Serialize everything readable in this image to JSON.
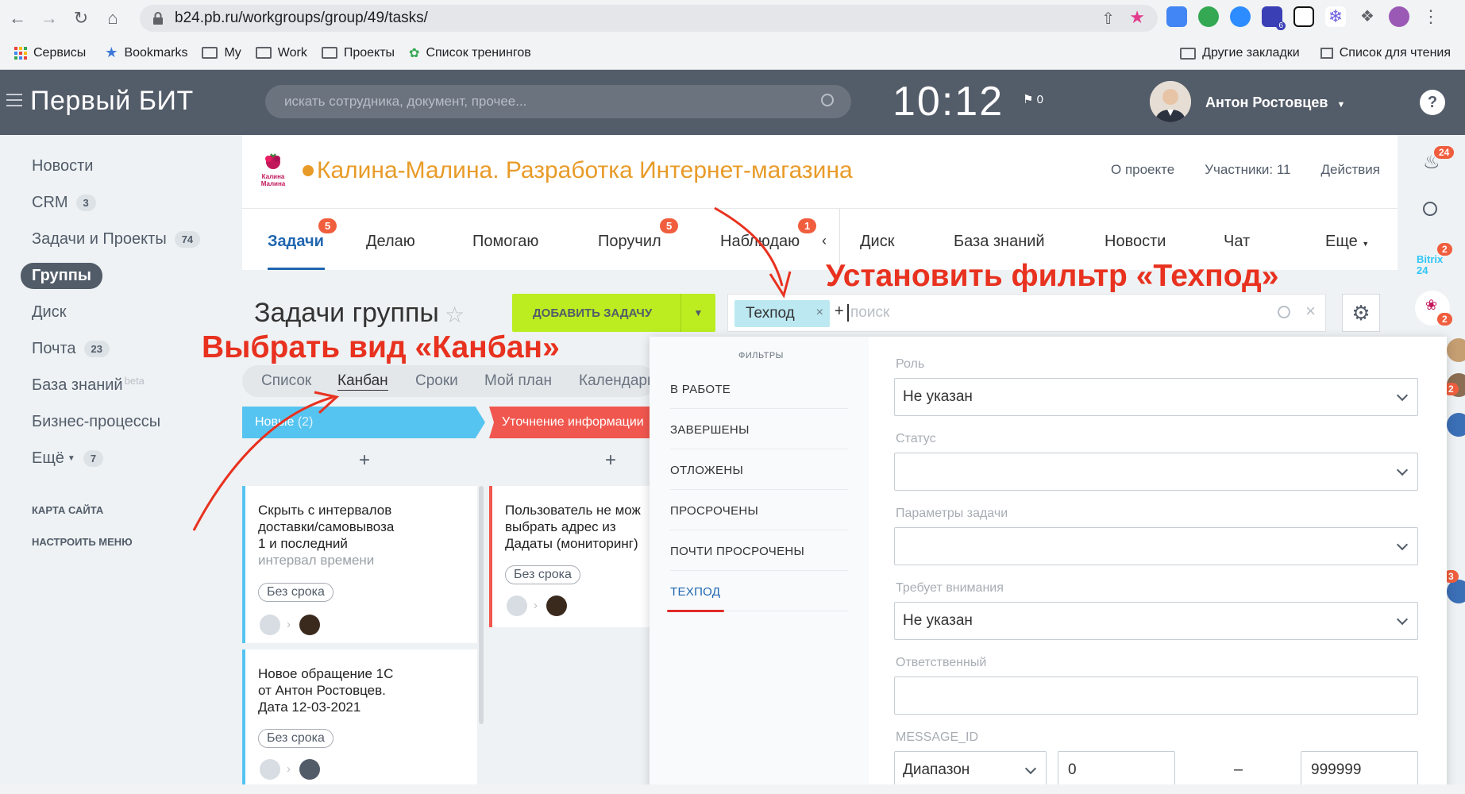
{
  "browser": {
    "url": "b24.pb.ru/workgroups/group/49/tasks/",
    "bookmarks": [
      "Сервисы",
      "Bookmarks",
      "My",
      "Work",
      "Проекты",
      "Список тренингов"
    ],
    "bookmarks_right": [
      "Другие закладки",
      "Список для чтения"
    ],
    "ext_badge": "6"
  },
  "header": {
    "brand": "Первый БИТ",
    "search_placeholder": "искать сотрудника, документ, прочее...",
    "time": "10:12",
    "flag_count": "0",
    "user_name": "Антон Ростовцев",
    "help": "?"
  },
  "left_menu": {
    "items": [
      {
        "label": "Новости"
      },
      {
        "label": "CRM",
        "count": "3"
      },
      {
        "label": "Задачи и Проекты",
        "count": "74"
      },
      {
        "label": "Группы"
      },
      {
        "label": "Диск"
      },
      {
        "label": "Почта",
        "count": "23"
      },
      {
        "label": "База знаний",
        "suffix": "beta"
      },
      {
        "label": "Бизнес-процессы"
      },
      {
        "label": "Ещё",
        "count": "7"
      }
    ],
    "sitemap": "КАРТА САЙТА",
    "configure": "НАСТРОИТЬ МЕНЮ"
  },
  "right_rail": {
    "bell_count": "24",
    "bitrix_count": "2",
    "logo_badge": "2",
    "edge_badge_1": "2",
    "edge_badge_2": "3",
    "bitrix_label": "Bitrix 24"
  },
  "project": {
    "title": "Калина-Малина. Разработка Интернет-магазина",
    "logo_text": "Калина Малина",
    "links": [
      "О проекте",
      "Участники: 11",
      "Действия"
    ]
  },
  "tabs": [
    {
      "label": "Задачи",
      "badge": "5"
    },
    {
      "label": "Делаю"
    },
    {
      "label": "Помогаю"
    },
    {
      "label": "Поручил",
      "badge": "5"
    },
    {
      "label": "Наблюдаю",
      "badge": "1"
    },
    {
      "label": "Диск"
    },
    {
      "label": "База знаний"
    },
    {
      "label": "Новости"
    },
    {
      "label": "Чат"
    },
    {
      "label": "Еще"
    }
  ],
  "page": {
    "title": "Задачи группы",
    "add_task": "ДОБАВИТЬ ЗАДАЧУ",
    "filter_chip": "Техпод",
    "filter_placeholder": "поиск"
  },
  "view_tabs": [
    "Список",
    "Канбан",
    "Сроки",
    "Мой план",
    "Календарь"
  ],
  "kanban": {
    "columns": [
      {
        "title": "Новые",
        "count": "(2)",
        "color": "#56c4f0"
      },
      {
        "title": "Уточнение информации",
        "color": "#f0574e"
      }
    ],
    "cards": [
      {
        "title": [
          "Скрыть с интервалов",
          "доставки/самовывоза",
          "1 и последний",
          "интервал времени"
        ],
        "badge": "Без срока"
      },
      {
        "title": [
          "Новое обращение 1С",
          "от Антон Ростовцев.",
          "Дата 12-03-2021"
        ],
        "badge": "Без срока"
      },
      {
        "title": [
          "Пользователь не мож",
          "выбрать адрес из",
          "Дадаты (мониторинг)"
        ],
        "badge": "Без срока"
      }
    ]
  },
  "filter_popup": {
    "presets_title": "ФИЛЬТРЫ",
    "presets": [
      "В РАБОТЕ",
      "ЗАВЕРШЕНЫ",
      "ОТЛОЖЕНЫ",
      "ПРОСРОЧЕНЫ",
      "ПОЧТИ ПРОСРОЧЕНЫ",
      "ТЕХПОД"
    ],
    "fields": [
      {
        "label": "Роль",
        "value": "Не указан"
      },
      {
        "label": "Статус",
        "value": ""
      },
      {
        "label": "Параметры задачи",
        "value": ""
      },
      {
        "label": "Требует внимания",
        "value": "Не указан"
      },
      {
        "label": "Ответственный",
        "value": ""
      },
      {
        "label": "MESSAGE_ID",
        "value": "Диапазон",
        "from": "0",
        "dash": "–",
        "to": "999999"
      }
    ]
  },
  "annotations": {
    "filter": "Установить фильтр «Техпод»",
    "kanban": "Выбрать вид «Канбан»"
  }
}
